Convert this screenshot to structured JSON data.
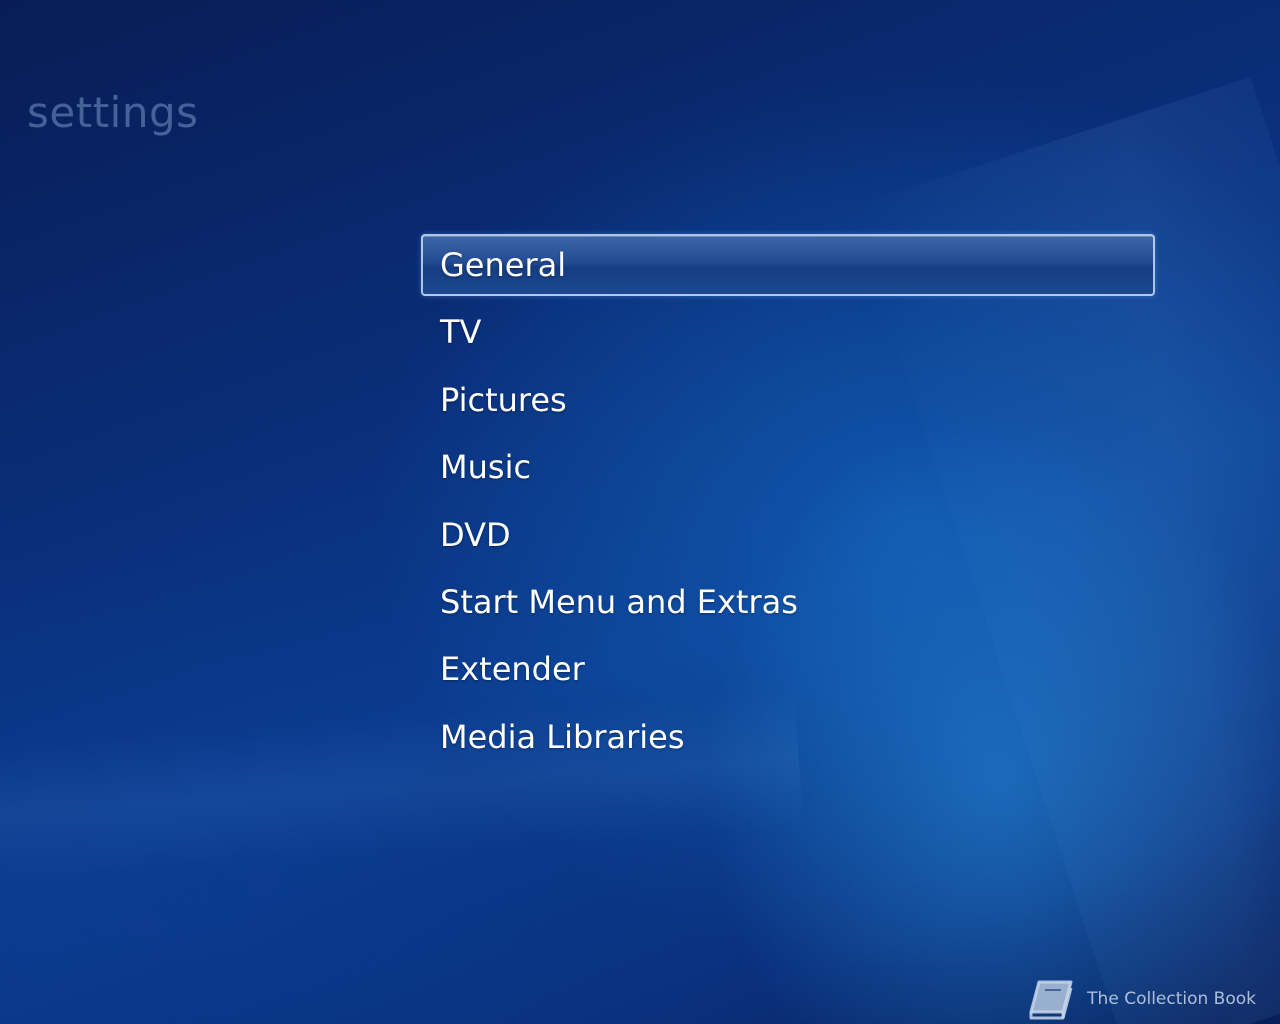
{
  "header": {
    "title": "settings"
  },
  "menu": {
    "items": [
      {
        "label": "General",
        "selected": true
      },
      {
        "label": "TV",
        "selected": false
      },
      {
        "label": "Pictures",
        "selected": false
      },
      {
        "label": "Music",
        "selected": false
      },
      {
        "label": "DVD",
        "selected": false
      },
      {
        "label": "Start Menu and Extras",
        "selected": false
      },
      {
        "label": "Extender",
        "selected": false
      },
      {
        "label": "Media Libraries",
        "selected": false
      }
    ]
  },
  "watermark": {
    "icon": "book-icon",
    "text": "The Collection Book"
  },
  "colors": {
    "background": "#0b3c8f",
    "title": "#7896c8",
    "highlight_border": "#c8dcf5",
    "text": "#ffffff"
  }
}
